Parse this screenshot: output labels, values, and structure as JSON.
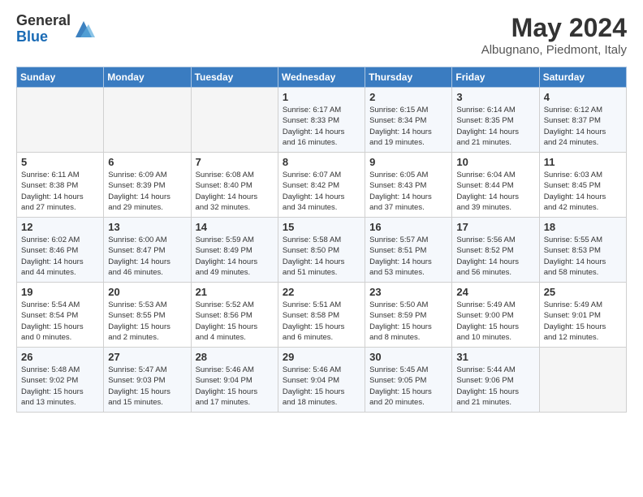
{
  "header": {
    "logo_general": "General",
    "logo_blue": "Blue",
    "title": "May 2024",
    "location": "Albugnano, Piedmont, Italy"
  },
  "weekdays": [
    "Sunday",
    "Monday",
    "Tuesday",
    "Wednesday",
    "Thursday",
    "Friday",
    "Saturday"
  ],
  "weeks": [
    [
      {
        "day": "",
        "info": ""
      },
      {
        "day": "",
        "info": ""
      },
      {
        "day": "",
        "info": ""
      },
      {
        "day": "1",
        "info": "Sunrise: 6:17 AM\nSunset: 8:33 PM\nDaylight: 14 hours\nand 16 minutes."
      },
      {
        "day": "2",
        "info": "Sunrise: 6:15 AM\nSunset: 8:34 PM\nDaylight: 14 hours\nand 19 minutes."
      },
      {
        "day": "3",
        "info": "Sunrise: 6:14 AM\nSunset: 8:35 PM\nDaylight: 14 hours\nand 21 minutes."
      },
      {
        "day": "4",
        "info": "Sunrise: 6:12 AM\nSunset: 8:37 PM\nDaylight: 14 hours\nand 24 minutes."
      }
    ],
    [
      {
        "day": "5",
        "info": "Sunrise: 6:11 AM\nSunset: 8:38 PM\nDaylight: 14 hours\nand 27 minutes."
      },
      {
        "day": "6",
        "info": "Sunrise: 6:09 AM\nSunset: 8:39 PM\nDaylight: 14 hours\nand 29 minutes."
      },
      {
        "day": "7",
        "info": "Sunrise: 6:08 AM\nSunset: 8:40 PM\nDaylight: 14 hours\nand 32 minutes."
      },
      {
        "day": "8",
        "info": "Sunrise: 6:07 AM\nSunset: 8:42 PM\nDaylight: 14 hours\nand 34 minutes."
      },
      {
        "day": "9",
        "info": "Sunrise: 6:05 AM\nSunset: 8:43 PM\nDaylight: 14 hours\nand 37 minutes."
      },
      {
        "day": "10",
        "info": "Sunrise: 6:04 AM\nSunset: 8:44 PM\nDaylight: 14 hours\nand 39 minutes."
      },
      {
        "day": "11",
        "info": "Sunrise: 6:03 AM\nSunset: 8:45 PM\nDaylight: 14 hours\nand 42 minutes."
      }
    ],
    [
      {
        "day": "12",
        "info": "Sunrise: 6:02 AM\nSunset: 8:46 PM\nDaylight: 14 hours\nand 44 minutes."
      },
      {
        "day": "13",
        "info": "Sunrise: 6:00 AM\nSunset: 8:47 PM\nDaylight: 14 hours\nand 46 minutes."
      },
      {
        "day": "14",
        "info": "Sunrise: 5:59 AM\nSunset: 8:49 PM\nDaylight: 14 hours\nand 49 minutes."
      },
      {
        "day": "15",
        "info": "Sunrise: 5:58 AM\nSunset: 8:50 PM\nDaylight: 14 hours\nand 51 minutes."
      },
      {
        "day": "16",
        "info": "Sunrise: 5:57 AM\nSunset: 8:51 PM\nDaylight: 14 hours\nand 53 minutes."
      },
      {
        "day": "17",
        "info": "Sunrise: 5:56 AM\nSunset: 8:52 PM\nDaylight: 14 hours\nand 56 minutes."
      },
      {
        "day": "18",
        "info": "Sunrise: 5:55 AM\nSunset: 8:53 PM\nDaylight: 14 hours\nand 58 minutes."
      }
    ],
    [
      {
        "day": "19",
        "info": "Sunrise: 5:54 AM\nSunset: 8:54 PM\nDaylight: 15 hours\nand 0 minutes."
      },
      {
        "day": "20",
        "info": "Sunrise: 5:53 AM\nSunset: 8:55 PM\nDaylight: 15 hours\nand 2 minutes."
      },
      {
        "day": "21",
        "info": "Sunrise: 5:52 AM\nSunset: 8:56 PM\nDaylight: 15 hours\nand 4 minutes."
      },
      {
        "day": "22",
        "info": "Sunrise: 5:51 AM\nSunset: 8:58 PM\nDaylight: 15 hours\nand 6 minutes."
      },
      {
        "day": "23",
        "info": "Sunrise: 5:50 AM\nSunset: 8:59 PM\nDaylight: 15 hours\nand 8 minutes."
      },
      {
        "day": "24",
        "info": "Sunrise: 5:49 AM\nSunset: 9:00 PM\nDaylight: 15 hours\nand 10 minutes."
      },
      {
        "day": "25",
        "info": "Sunrise: 5:49 AM\nSunset: 9:01 PM\nDaylight: 15 hours\nand 12 minutes."
      }
    ],
    [
      {
        "day": "26",
        "info": "Sunrise: 5:48 AM\nSunset: 9:02 PM\nDaylight: 15 hours\nand 13 minutes."
      },
      {
        "day": "27",
        "info": "Sunrise: 5:47 AM\nSunset: 9:03 PM\nDaylight: 15 hours\nand 15 minutes."
      },
      {
        "day": "28",
        "info": "Sunrise: 5:46 AM\nSunset: 9:04 PM\nDaylight: 15 hours\nand 17 minutes."
      },
      {
        "day": "29",
        "info": "Sunrise: 5:46 AM\nSunset: 9:04 PM\nDaylight: 15 hours\nand 18 minutes."
      },
      {
        "day": "30",
        "info": "Sunrise: 5:45 AM\nSunset: 9:05 PM\nDaylight: 15 hours\nand 20 minutes."
      },
      {
        "day": "31",
        "info": "Sunrise: 5:44 AM\nSunset: 9:06 PM\nDaylight: 15 hours\nand 21 minutes."
      },
      {
        "day": "",
        "info": ""
      }
    ]
  ]
}
